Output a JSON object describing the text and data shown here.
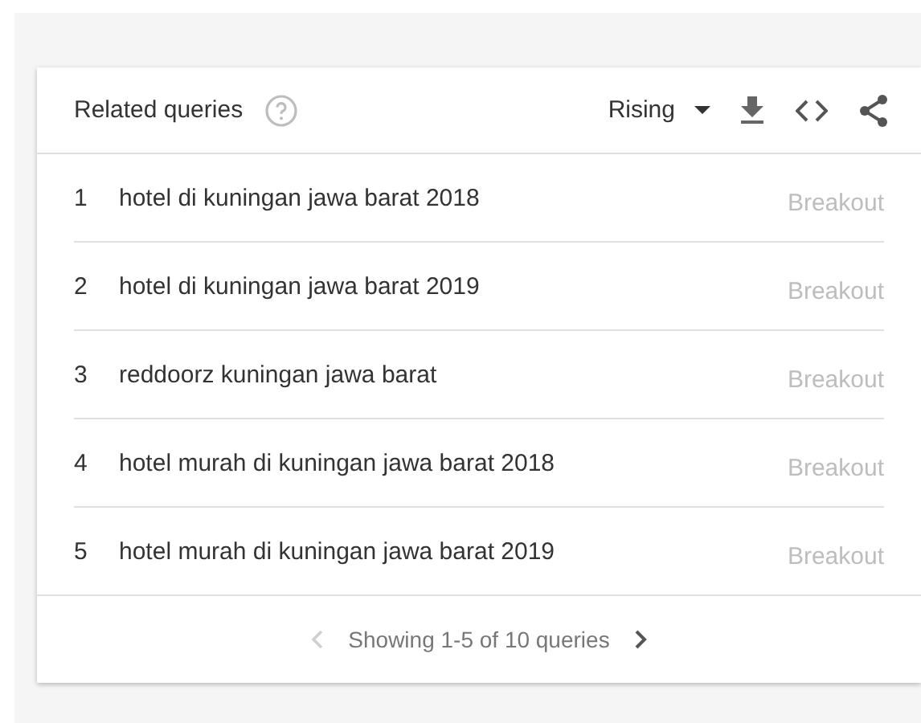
{
  "card": {
    "title": "Related queries",
    "filter": "Rising"
  },
  "queries": [
    {
      "rank": "1",
      "query": "hotel di kuningan jawa barat 2018",
      "value": "Breakout"
    },
    {
      "rank": "2",
      "query": "hotel di kuningan jawa barat 2019",
      "value": "Breakout"
    },
    {
      "rank": "3",
      "query": "reddoorz kuningan jawa barat",
      "value": "Breakout"
    },
    {
      "rank": "4",
      "query": "hotel murah di kuningan jawa barat 2018",
      "value": "Breakout"
    },
    {
      "rank": "5",
      "query": "hotel murah di kuningan jawa barat 2019",
      "value": "Breakout"
    }
  ],
  "pagination": {
    "text": "Showing 1-5 of 10 queries",
    "previous": {
      "disabled": true
    },
    "next": {
      "disabled": false
    }
  }
}
